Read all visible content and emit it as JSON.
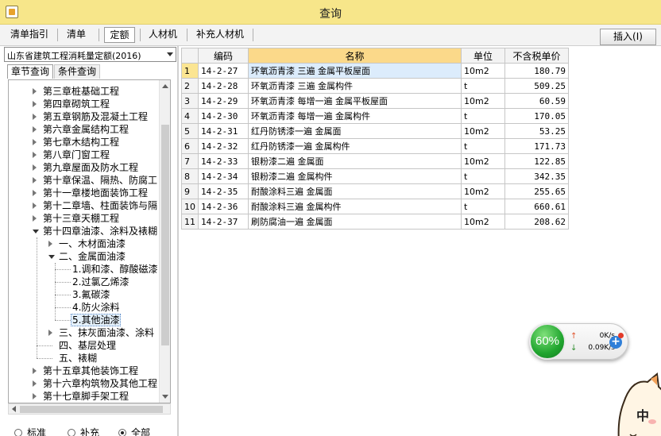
{
  "window": {
    "title": "查询"
  },
  "toolbar": {
    "tabs": [
      {
        "label": "清单指引"
      },
      {
        "label": "清单"
      },
      {
        "label": "定额"
      },
      {
        "label": "人材机"
      },
      {
        "label": "补充人材机"
      }
    ],
    "insert_button": "插入(I)"
  },
  "left_panel": {
    "quota_library": "山东省建筑工程消耗量定额(2016)",
    "subtabs": [
      {
        "label": "章节查询"
      },
      {
        "label": "条件查询"
      }
    ],
    "tree": [
      {
        "label": "第三章桩基础工程"
      },
      {
        "label": "第四章砌筑工程"
      },
      {
        "label": "第五章钢筋及混凝土工程"
      },
      {
        "label": "第六章金属结构工程"
      },
      {
        "label": "第七章木结构工程"
      },
      {
        "label": "第八章门窗工程"
      },
      {
        "label": "第九章屋面及防水工程"
      },
      {
        "label": "第十章保温、隔热、防腐工"
      },
      {
        "label": "第十一章楼地面装饰工程"
      },
      {
        "label": "第十二章墙、柱面装饰与隔"
      },
      {
        "label": "第十三章天棚工程"
      },
      {
        "label": "第十四章油漆、涂料及裱糊"
      },
      {
        "label": "一、木材面油漆"
      },
      {
        "label": "二、金属面油漆"
      },
      {
        "label": "1.调和漆、醇酸磁漆"
      },
      {
        "label": "2.过氯乙烯漆"
      },
      {
        "label": "3.氟碳漆"
      },
      {
        "label": "4.防火涂料"
      },
      {
        "label": "5.其他油漆"
      },
      {
        "label": "三、抹灰面油漆、涂料"
      },
      {
        "label": "四、基层处理"
      },
      {
        "label": "五、裱糊"
      },
      {
        "label": "第十五章其他装饰工程"
      },
      {
        "label": "第十六章构筑物及其他工程"
      },
      {
        "label": "第十七章脚手架工程"
      }
    ],
    "radio_options": [
      {
        "label": "标准",
        "checked": false
      },
      {
        "label": "补充",
        "checked": false
      },
      {
        "label": "全部",
        "checked": true
      }
    ]
  },
  "grid": {
    "columns": [
      "",
      "编码",
      "名称",
      "单位",
      "不含税单价"
    ],
    "rows": [
      {
        "no": "1",
        "code": "14-2-27",
        "name": "环氧沥青漆 三遍 金属平板屋面",
        "unit": "10m2",
        "price": "180.79"
      },
      {
        "no": "2",
        "code": "14-2-28",
        "name": "环氧沥青漆 三遍 金属构件",
        "unit": "t",
        "price": "509.25"
      },
      {
        "no": "3",
        "code": "14-2-29",
        "name": "环氧沥青漆 每增一遍 金属平板屋面",
        "unit": "10m2",
        "price": "60.59"
      },
      {
        "no": "4",
        "code": "14-2-30",
        "name": "环氧沥青漆 每增一遍 金属构件",
        "unit": "t",
        "price": "170.05"
      },
      {
        "no": "5",
        "code": "14-2-31",
        "name": "红丹防锈漆一遍 金属面",
        "unit": "10m2",
        "price": "53.25"
      },
      {
        "no": "6",
        "code": "14-2-32",
        "name": "红丹防锈漆一遍 金属构件",
        "unit": "t",
        "price": "171.73"
      },
      {
        "no": "7",
        "code": "14-2-33",
        "name": "银粉漆二遍 金属面",
        "unit": "10m2",
        "price": "122.85"
      },
      {
        "no": "8",
        "code": "14-2-34",
        "name": "银粉漆二遍 金属构件",
        "unit": "t",
        "price": "342.35"
      },
      {
        "no": "9",
        "code": "14-2-35",
        "name": "耐酸涂料三遍 金属面",
        "unit": "10m2",
        "price": "255.65"
      },
      {
        "no": "10",
        "code": "14-2-36",
        "name": "耐酸涂料三遍 金属构件",
        "unit": "t",
        "price": "660.61"
      },
      {
        "no": "11",
        "code": "14-2-37",
        "name": "刷防腐油一遍 金属面",
        "unit": "10m2",
        "price": "208.62"
      }
    ]
  },
  "net_widget": {
    "percent": "60%",
    "up_speed": "0K/s",
    "down_speed": "0.09K/s",
    "up_arrow": "↑",
    "down_arrow": "↓"
  },
  "mascot": {
    "text": "中"
  },
  "colors": {
    "titlebar": "#f7e68a",
    "header_sorted": "#fbd98a",
    "row_indicator_current": "#fbe592",
    "selection": "#dcecfc",
    "widget_green": "#20a52e"
  },
  "icons": {
    "app": "app-icon",
    "combo": "chevron-down-icon",
    "widget_plus": "plus-icon"
  }
}
